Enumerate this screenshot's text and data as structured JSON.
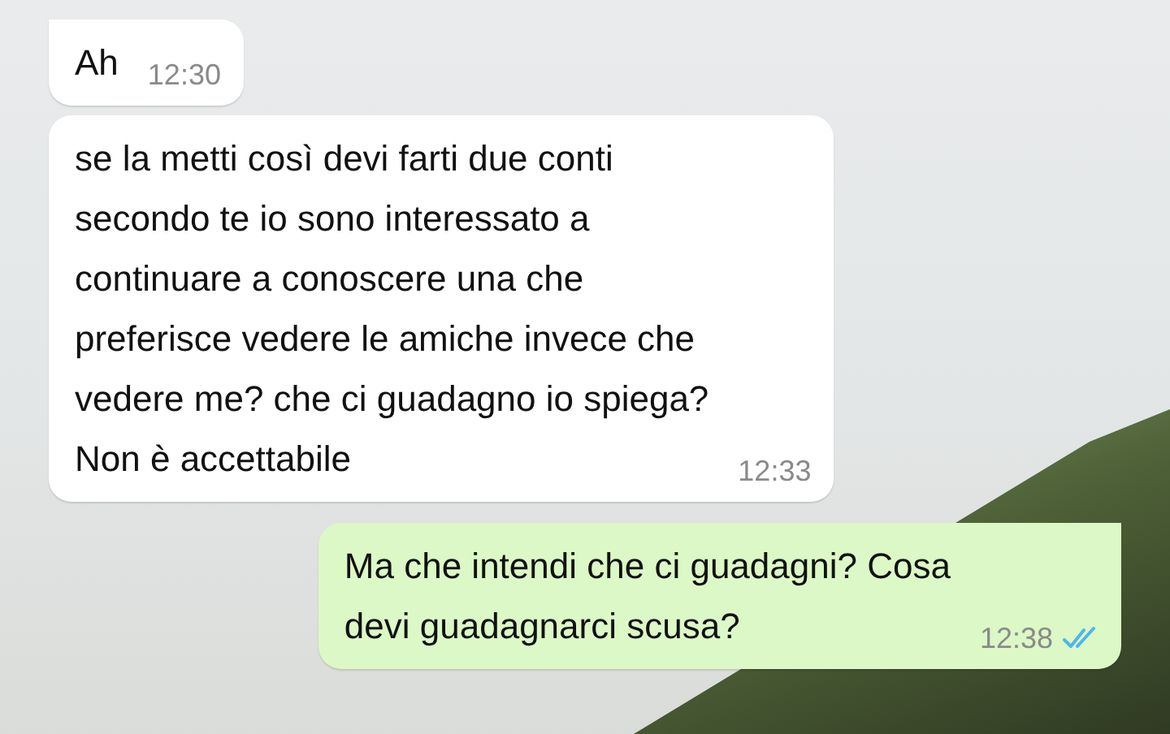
{
  "messages": [
    {
      "kind": "incoming",
      "text": "Ah",
      "time": "12:30"
    },
    {
      "kind": "incoming",
      "text": "se la metti così devi farti due conti\nsecondo te io sono interessato a\ncontinuare a conoscere una che\npreferisce vedere le amiche invece che\nvedere me? che ci guadagno io spiega?\nNon è accettabile",
      "time": "12:33"
    },
    {
      "kind": "outgoing",
      "text": "Ma che intendi che ci guadagni? Cosa\ndevi guadagnarci scusa?",
      "time": "12:38",
      "read": true
    }
  ]
}
